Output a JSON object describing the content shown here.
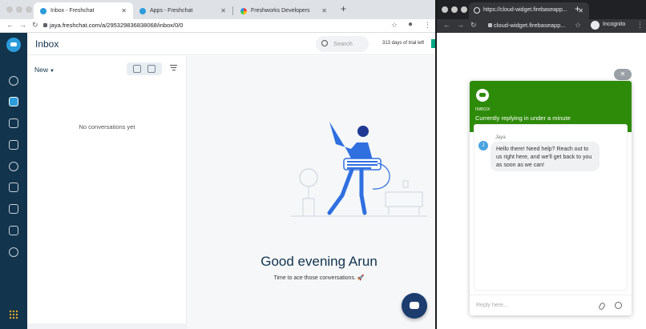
{
  "left_window": {
    "tabs": [
      {
        "label": "Inbox - Freshchat",
        "icon": "freshchat-icon",
        "active": true
      },
      {
        "label": "Apps - Freshchat",
        "icon": "freshchat-icon",
        "active": false
      },
      {
        "label": "Freshworks Developers",
        "icon": "freshworks-icon",
        "active": false
      }
    ],
    "url": "jaya.freshchat.com/a/295329836838068/inbox/0/0",
    "app": {
      "header_title": "Inbox",
      "search_placeholder": "Search",
      "trial_text": "313 days of trial left",
      "filter_label": "New",
      "empty_text": "No conversations yet",
      "greeting": "Good evening Arun",
      "subtext": "Time to ace those conversations. 🚀"
    }
  },
  "right_window": {
    "tab_title": "https://cloud-widget.firebaseapp...",
    "url": "cloud-widget.firebaseapp...",
    "incognito_label": "Incognito",
    "widget": {
      "close_symbol": "✕",
      "header_label": "INBOX",
      "status": "Currently replying in under a minute",
      "agent_name": "Jaya",
      "agent_initial": "J",
      "message": "Hello there! Need help? Reach out to us right here, and we'll get back to you as soon as we can!",
      "reply_placeholder": "Reply here..."
    }
  },
  "colors": {
    "rail": "#12344d",
    "accent": "#2c9cdb",
    "widget_header": "#2e8b0a",
    "fab": "#1d3d6e"
  }
}
